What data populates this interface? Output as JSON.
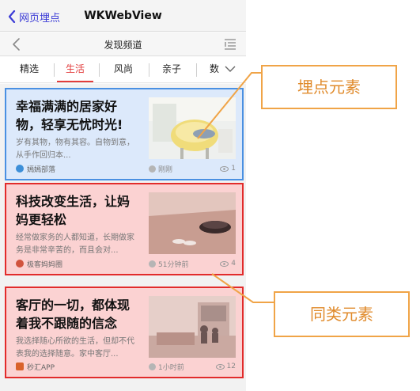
{
  "navbar": {
    "back_label": "网页埋点",
    "title": "WKWebView"
  },
  "channel": {
    "title": "发现频道"
  },
  "tabs": [
    {
      "label": "精选",
      "active": false
    },
    {
      "label": "生活",
      "active": true
    },
    {
      "label": "风尚",
      "active": false
    },
    {
      "label": "亲子",
      "active": false
    },
    {
      "label": "数",
      "active": false
    }
  ],
  "articles": [
    {
      "title": "幸福满满的居家好物，轻享无忧时光!",
      "summary": "岁有其物，物有其容。自物到意，从手作回归本...",
      "source": "嫣嫣部落",
      "time": "刚刚",
      "views": "1"
    },
    {
      "title": "科技改变生活，让妈妈更轻松",
      "summary": "经常做家务的人都知道，长期做家务是非常辛苦的，而且会对...",
      "source": "极客妈妈圈",
      "time": "51分钟前",
      "views": "4"
    },
    {
      "title": "客厅的一切，都体现着我不跟随的信念",
      "summary": "我选择随心所欲的生活，但却不代表我的选择随意。家中客厅...",
      "source": "秒汇APP",
      "time": "1小时前",
      "views": "12"
    }
  ],
  "callouts": {
    "tracked": "埋点元素",
    "similar": "同类元素"
  },
  "colors": {
    "tracked_border": "#4a90e2",
    "similar_border": "#e22b2b",
    "accent": "#e23c3c",
    "callout": "#f0a447"
  }
}
